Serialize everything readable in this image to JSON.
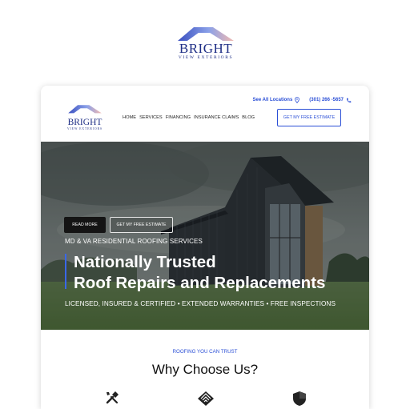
{
  "brand": {
    "name": "BRIGHT",
    "tagline": "VIEW EXTERIORS",
    "accent": "#1f2f86",
    "link_color": "#2b4fd6"
  },
  "topbar": {
    "locations_label": "See All Locations",
    "phone": "(301) 266 -5657"
  },
  "nav": {
    "items": [
      "HOME",
      "SERVICES",
      "FINANCING",
      "INSURANCE CLAIMS",
      "BLOG"
    ],
    "cta": "GET MY FREE ESTIMATE"
  },
  "hero": {
    "read_more": "READ MORE",
    "estimate": "GET MY FREE ESTIMATE",
    "eyebrow": "MD & VA RESIDENTIAL ROOFING SERVICES",
    "title_line1": "Nationally Trusted",
    "title_line2": "Roof Repairs and Replacements",
    "features": "LICENSED, INSURED & CERTIFIED  •  EXTENDED WARRANTIES  •  FREE INSPECTIONS"
  },
  "why": {
    "eyebrow": "ROOFING YOU CAN TRUST",
    "title": "Why Choose Us?",
    "icons": [
      "tools-icon",
      "handshake-icon",
      "shield-icon"
    ]
  }
}
